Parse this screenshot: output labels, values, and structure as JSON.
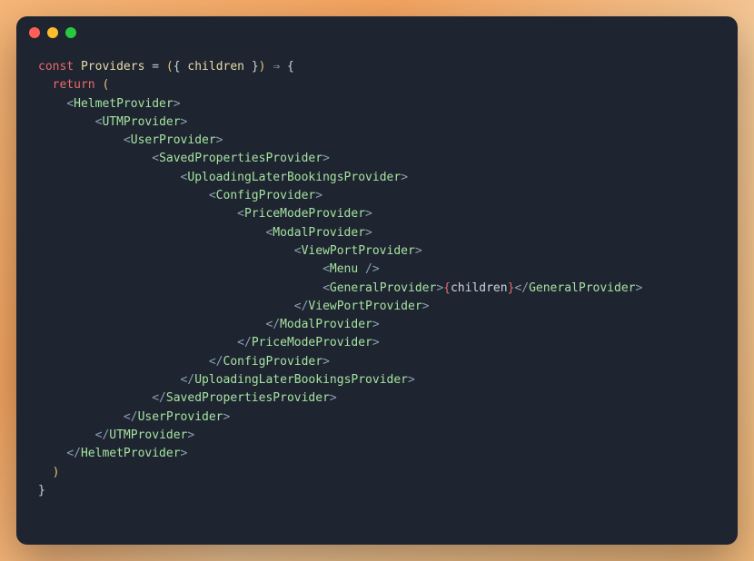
{
  "window": {
    "controls": [
      "close",
      "minimize",
      "maximize"
    ]
  },
  "code": {
    "keywords": {
      "const": "const",
      "return": "return"
    },
    "fn_name": "Providers",
    "param": "children",
    "arrow": "⇒",
    "expr": "children",
    "lines": [
      {
        "indent": 0,
        "kind": "sig"
      },
      {
        "indent": 1,
        "kind": "return_open"
      },
      {
        "indent": 2,
        "kind": "open",
        "tag": "HelmetProvider"
      },
      {
        "indent": 4,
        "kind": "open",
        "tag": "UTMProvider"
      },
      {
        "indent": 6,
        "kind": "open",
        "tag": "UserProvider"
      },
      {
        "indent": 8,
        "kind": "open",
        "tag": "SavedPropertiesProvider"
      },
      {
        "indent": 10,
        "kind": "open",
        "tag": "UploadingLaterBookingsProvider"
      },
      {
        "indent": 12,
        "kind": "open",
        "tag": "ConfigProvider"
      },
      {
        "indent": 14,
        "kind": "open",
        "tag": "PriceModeProvider"
      },
      {
        "indent": 16,
        "kind": "open",
        "tag": "ModalProvider"
      },
      {
        "indent": 18,
        "kind": "open",
        "tag": "ViewPortProvider"
      },
      {
        "indent": 20,
        "kind": "self",
        "tag": "Menu"
      },
      {
        "indent": 20,
        "kind": "inline_expr",
        "tag": "GeneralProvider",
        "expr": "children"
      },
      {
        "indent": 18,
        "kind": "close",
        "tag": "ViewPortProvider"
      },
      {
        "indent": 16,
        "kind": "close",
        "tag": "ModalProvider"
      },
      {
        "indent": 14,
        "kind": "close",
        "tag": "PriceModeProvider"
      },
      {
        "indent": 12,
        "kind": "close",
        "tag": "ConfigProvider"
      },
      {
        "indent": 10,
        "kind": "close",
        "tag": "UploadingLaterBookingsProvider"
      },
      {
        "indent": 8,
        "kind": "close",
        "tag": "SavedPropertiesProvider"
      },
      {
        "indent": 6,
        "kind": "close",
        "tag": "UserProvider"
      },
      {
        "indent": 4,
        "kind": "close",
        "tag": "UTMProvider"
      },
      {
        "indent": 2,
        "kind": "close",
        "tag": "HelmetProvider"
      },
      {
        "indent": 1,
        "kind": "return_close"
      },
      {
        "indent": 0,
        "kind": "fn_close"
      }
    ]
  }
}
